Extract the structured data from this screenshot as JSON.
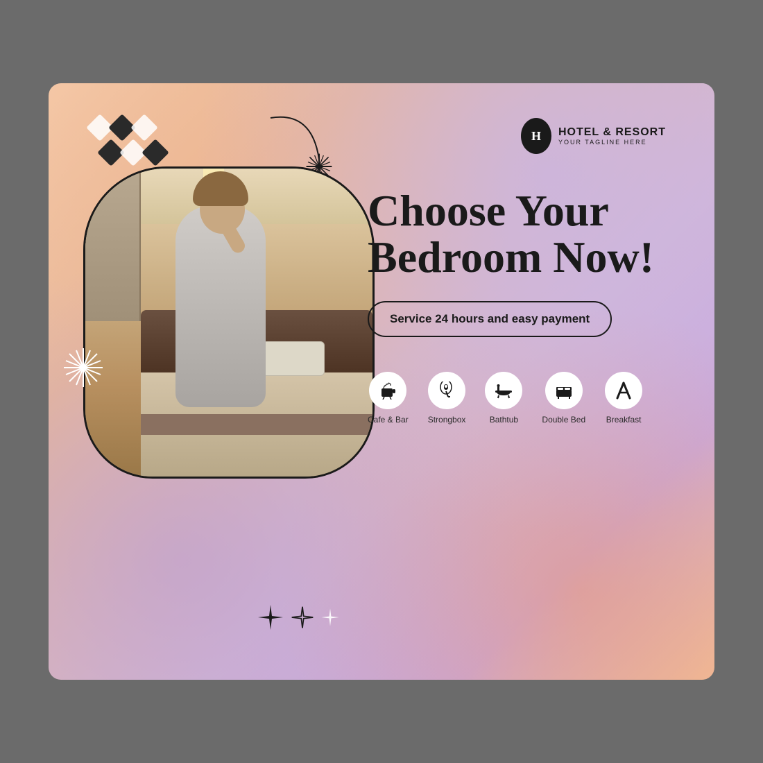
{
  "card": {
    "background": "gradient peach-lavender"
  },
  "logo": {
    "letter": "H",
    "name": "HOTEL & RESORT",
    "tagline": "YOUR TAGLINE HERE"
  },
  "heading": {
    "line1": "Choose Your",
    "line2": "Bedroom Now!"
  },
  "service_badge": {
    "text": "Service 24 hours and easy payment"
  },
  "amenities": [
    {
      "icon": "☕",
      "label": "Cafe & Bar"
    },
    {
      "icon": "🔑",
      "label": "Strongbox"
    },
    {
      "icon": "🛁",
      "label": "Bathtub"
    },
    {
      "icon": "🛏",
      "label": "Double Bed"
    },
    {
      "icon": "✖",
      "label": "Breakfast"
    }
  ],
  "photo_alt": "Woman in robe sitting on hotel bed"
}
